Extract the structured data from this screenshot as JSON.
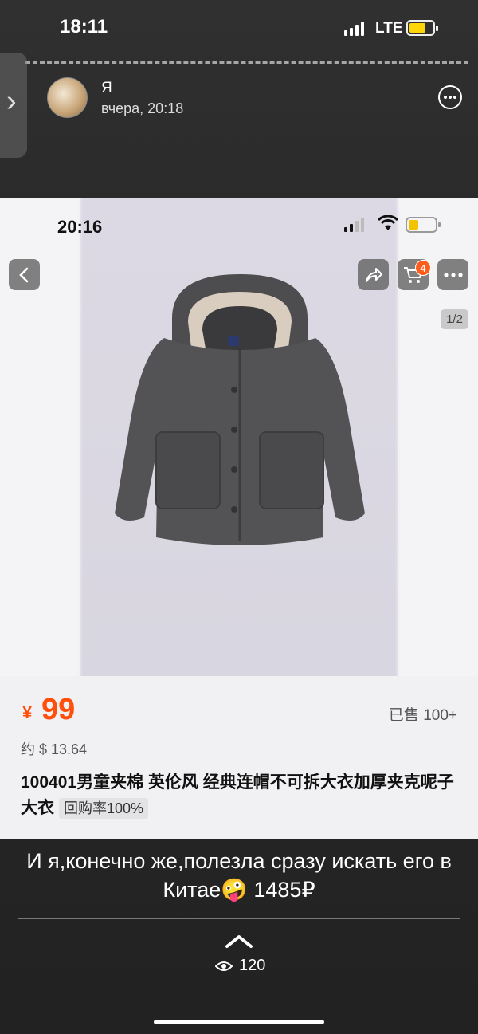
{
  "status_bar": {
    "time": "18:11",
    "network": "LTE",
    "battery_color": "#ffd60a"
  },
  "story": {
    "author": "Я",
    "timestamp": "вчера, 20:18",
    "caption": "И я,конечно же,полезла сразу искать его в Китае🤪 1485₽",
    "views": "120"
  },
  "embedded": {
    "status_time": "20:16",
    "cart_count": "4",
    "page_indicator": "1/2",
    "price_symbol": "¥",
    "price": "99",
    "sold": "已售 100+",
    "approx_price": "约 $ 13.64",
    "title": "100401男童夹棉 英伦风 经典连帽不可拆大衣加厚夹克呢子大衣",
    "repurchase": "回购率100%",
    "accent_color": "#ff4f0a"
  },
  "icons": [
    "chevron-right-icon",
    "more-icon",
    "back-icon",
    "share-icon",
    "cart-icon",
    "ellipsis-icon",
    "chevron-up-icon",
    "eye-icon",
    "wifi-icon"
  ]
}
